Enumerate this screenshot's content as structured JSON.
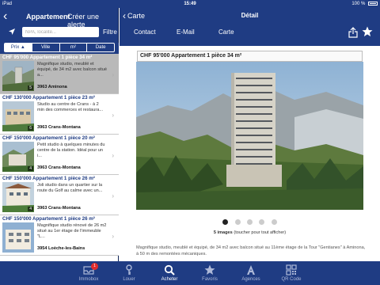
{
  "status_bar": {
    "device": "iPad",
    "time": "15:49",
    "battery": "100 %"
  },
  "left": {
    "title": "Appartement",
    "alert_link": "Créer une alerte",
    "search": {
      "placeholder": "NPA, localité...",
      "value": ""
    },
    "filter_label": "Filtre",
    "sort": {
      "price": "Prix ▲",
      "town": "Ville",
      "area": "m²",
      "date": "Date"
    },
    "items": [
      {
        "title": "CHF 95'000 Appartement 1 pièce 34 m²",
        "desc": "Magnifique studio, meublé et équipé, de 34 m2 avec balcon situé a...",
        "location": "3963 Aminona",
        "count": "5"
      },
      {
        "title": "CHF 130'000 Appartement 1 pièce 23 m²",
        "desc": "Studio au centre de Crans - à 2 min des commerces et restaura...",
        "location": "3963 Crans-Montana",
        "count": "6"
      },
      {
        "title": "CHF 150'000 Appartement 1 pièce 20 m²",
        "desc": "Petit studio à quelques minutes du centre de la station. Idéal pour un i...",
        "location": "3963 Crans-Montana",
        "count": "4"
      },
      {
        "title": "CHF 150'000 Appartement 1 pièce 26 m²",
        "desc": "Joli studio dans un quartier sur la route du Golf au calme avec un...",
        "location": "3963 Crans-Montana",
        "count": "4"
      },
      {
        "title": "CHF 150'000 Appartement 1 pièce 26 m²",
        "desc": "Magnifique studio rénové de 26 m2 situé au 1er étage de l'immeuble \"L...",
        "location": "3954 Loèche-les-Bains",
        "count": ""
      }
    ]
  },
  "right": {
    "back_label": "Carte",
    "title": "Détail",
    "tabs": {
      "contact": "Contact",
      "email": "E-Mail",
      "map": "Carte"
    },
    "listing_title": "CHF 95'000 Appartement 1 pièce 34 m²",
    "images_count": "5 images",
    "images_hint": "(toucher pour tout afficher)",
    "description": "Magnifique studio, meublé et équipé, de 34 m2 avec balcon situé au 11ème étage de la Tour \"Gentianes\" à Aminona, à 50 m des remontées mécaniques."
  },
  "tabbar": {
    "immobox": "Immobox",
    "immobox_badge": "1",
    "rent": "Louer",
    "buy": "Acheter",
    "favorites": "Favoris",
    "agencies": "Agences",
    "qr": "QR Code"
  },
  "colors": {
    "accent": "#1f3c83",
    "badge": "#e02b2b"
  }
}
